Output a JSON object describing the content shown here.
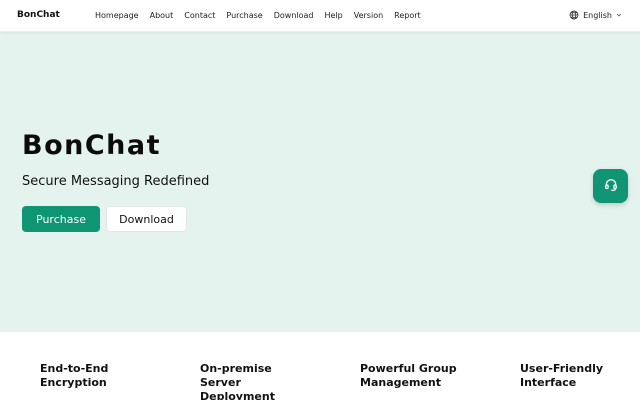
{
  "nav": {
    "brand": "BonChat",
    "links": [
      "Homepage",
      "About",
      "Contact",
      "Purchase",
      "Download",
      "Help",
      "Version",
      "Report"
    ],
    "language": "English",
    "globe_icon": "globe-icon",
    "chevron_icon": "chevron-down-icon"
  },
  "hero": {
    "title": "BonChat",
    "subtitle": "Secure Messaging Redefined",
    "primary_button": "Purchase",
    "secondary_button": "Download"
  },
  "support": {
    "icon": "headset-icon"
  },
  "features": [
    {
      "title": "End-to-End Encryption"
    },
    {
      "title": "On-premise Server Deployment"
    },
    {
      "title": "Powerful Group Management"
    },
    {
      "title": "User-Friendly Interface"
    }
  ],
  "colors": {
    "accent": "#0f9474",
    "hero_background": "#e5f3ef"
  }
}
